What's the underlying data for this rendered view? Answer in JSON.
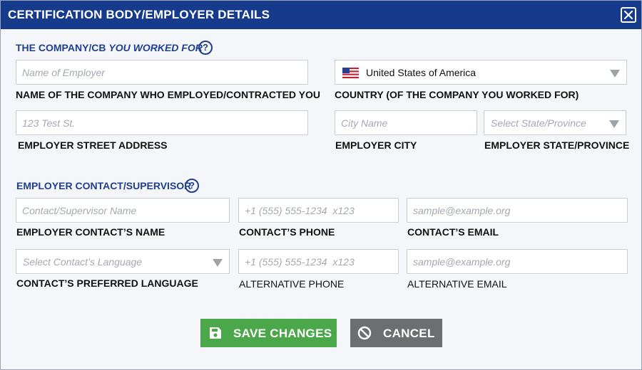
{
  "dialog": {
    "title": "CERTIFICATION BODY/EMPLOYER DETAILS"
  },
  "section_company": {
    "title_prefix": "THE COMPANY/CB ",
    "title_emphasis": "YOU WORKED FOR",
    "help": "?"
  },
  "employer_name": {
    "placeholder": "Name of Employer",
    "label": "NAME OF THE COMPANY WHO EMPLOYED/CONTRACTED YOU"
  },
  "country": {
    "value": "United States of America",
    "label": "COUNTRY (OF THE COMPANY YOU WORKED FOR)",
    "flag_icon": "us-flag-icon"
  },
  "street": {
    "placeholder": "123 Test St.",
    "label": "EMPLOYER STREET ADDRESS"
  },
  "city": {
    "placeholder": "City Name",
    "label": "EMPLOYER CITY"
  },
  "state": {
    "placeholder": "Select State/Province",
    "label": "EMPLOYER STATE/PROVINCE"
  },
  "section_contact": {
    "title": "EMPLOYER CONTACT/SUPERVISOR",
    "help": "?"
  },
  "contact_name": {
    "placeholder": "Contact/Supervisor Name",
    "label": "EMPLOYER CONTACT’S NAME"
  },
  "contact_phone": {
    "placeholder": "+1 (555) 555-1234  x123",
    "label": "CONTACT’S PHONE"
  },
  "contact_email": {
    "placeholder": "sample@example.org",
    "label": "CONTACT’S EMAIL"
  },
  "contact_language": {
    "placeholder": "Select Contact’s Language",
    "label": "CONTACT’S PREFERRED LANGUAGE"
  },
  "alt_phone": {
    "placeholder": "+1 (555) 555-1234  x123",
    "label": "ALTERNATIVE PHONE"
  },
  "alt_email": {
    "placeholder": "sample@example.org",
    "label": "ALTERNATIVE EMAIL"
  },
  "buttons": {
    "save": "SAVE CHANGES",
    "cancel": "CANCEL"
  },
  "colors": {
    "title_bar": "#163a8c",
    "section_title": "#1f3f91",
    "save_button": "#4aa84a",
    "cancel_button": "#6c6e71"
  }
}
